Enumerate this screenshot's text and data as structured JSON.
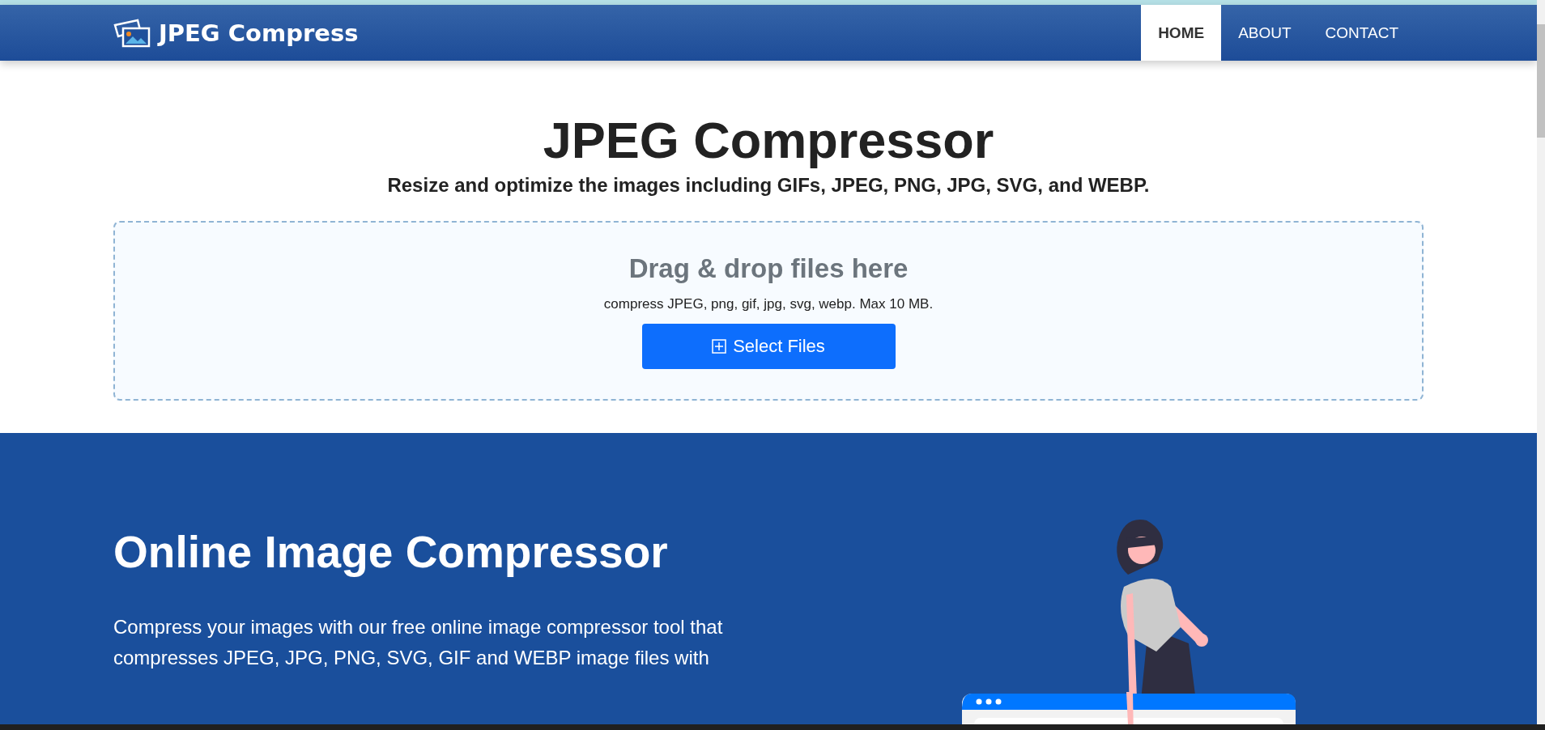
{
  "header": {
    "logo_text": "JPEG Compress",
    "nav": [
      {
        "label": "HOME",
        "selected": true
      },
      {
        "label": "ABOUT",
        "selected": false
      },
      {
        "label": "CONTACT",
        "selected": false
      }
    ]
  },
  "hero": {
    "title": "JPEG Compressor",
    "subtitle": "Resize and optimize the images including GIFs, JPEG, PNG, JPG, SVG, and WEBP.",
    "dropzone": {
      "title": "Drag & drop files here",
      "hint": "compress JPEG, png, gif, jpg, svg, webp. Max 10 MB.",
      "button": "Select Files"
    }
  },
  "about": {
    "heading": "Online Image Compressor",
    "paragraph": "Compress your images with our free online image compressor tool that compresses JPEG, JPG, PNG, SVG, GIF and WEBP image files with"
  }
}
